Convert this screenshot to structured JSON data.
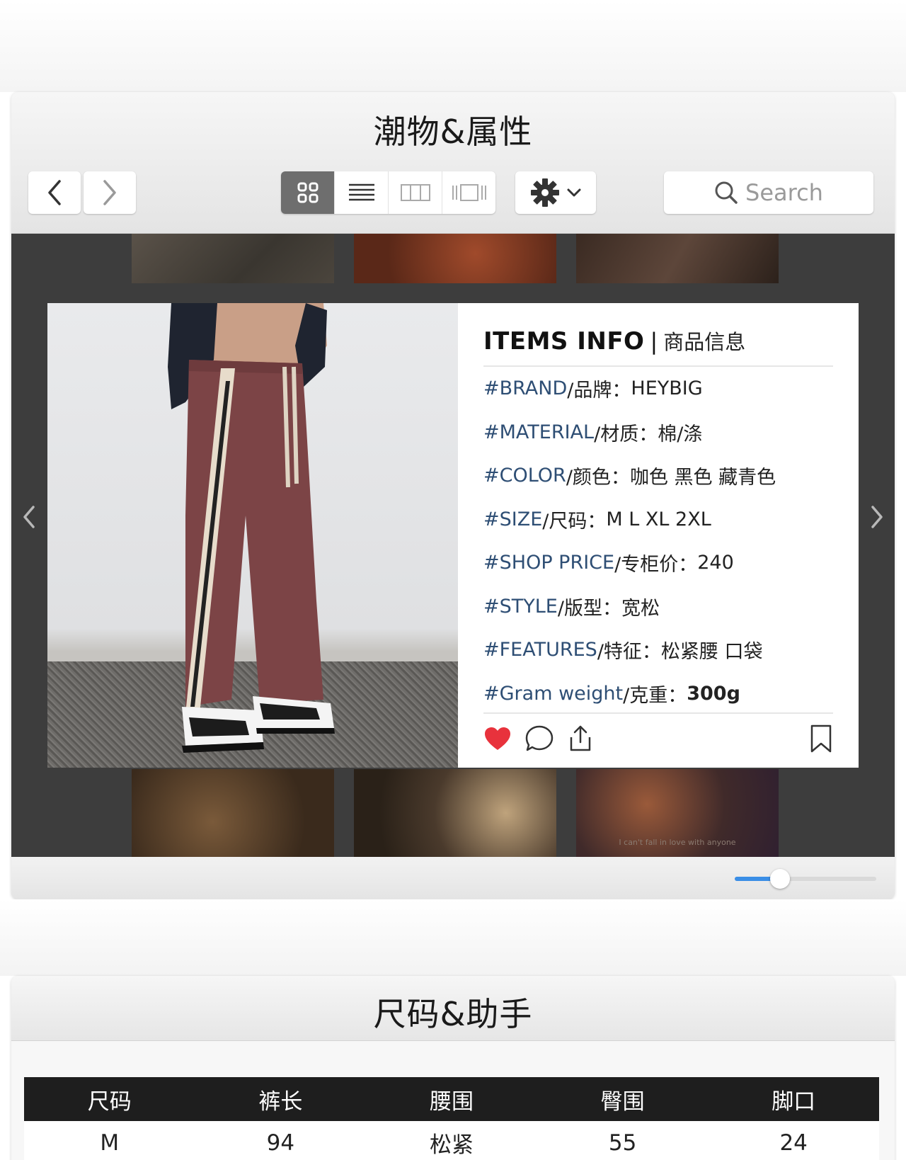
{
  "window1": {
    "title": "潮物&属性",
    "search_placeholder": "Search"
  },
  "gallery": {
    "bottom_caption": "I can't fall in love with anyone"
  },
  "items_info": {
    "title": "ITEMS INFO",
    "separator": "|",
    "subtitle": "商品信息",
    "rows": [
      {
        "key": "#BRAND",
        "label": "/品牌：",
        "value": "HEYBIG"
      },
      {
        "key": "#MATERIAL",
        "label": "/材质：",
        "value": "棉/涤"
      },
      {
        "key": "#COLOR",
        "label": "/颜色：",
        "value": "咖色 黑色 藏青色"
      },
      {
        "key": "#SIZE",
        "label": "/尺码：",
        "value": "M L XL 2XL"
      },
      {
        "key": "#SHOP PRICE",
        "label": "/专柜价：",
        "value": "240"
      },
      {
        "key": "#STYLE",
        "label": "/版型：",
        "value": "宽松"
      },
      {
        "key": "#FEATURES",
        "label": "/特征：",
        "value": "松紧腰 口袋"
      },
      {
        "key": "#Gram weight",
        "label": "/克重：",
        "value": "300g"
      }
    ]
  },
  "slider": {
    "value": 0.32
  },
  "colors": {
    "accent": "#3a8ee6",
    "heart": "#e8323c",
    "key_text": "#2e4e74"
  },
  "window2": {
    "title": "尺码&助手",
    "table": {
      "headers": [
        "尺码",
        "裤长",
        "腰围",
        "臀围",
        "脚口"
      ],
      "rows": [
        [
          "M",
          "94",
          "松紧",
          "55",
          "24"
        ]
      ]
    }
  }
}
